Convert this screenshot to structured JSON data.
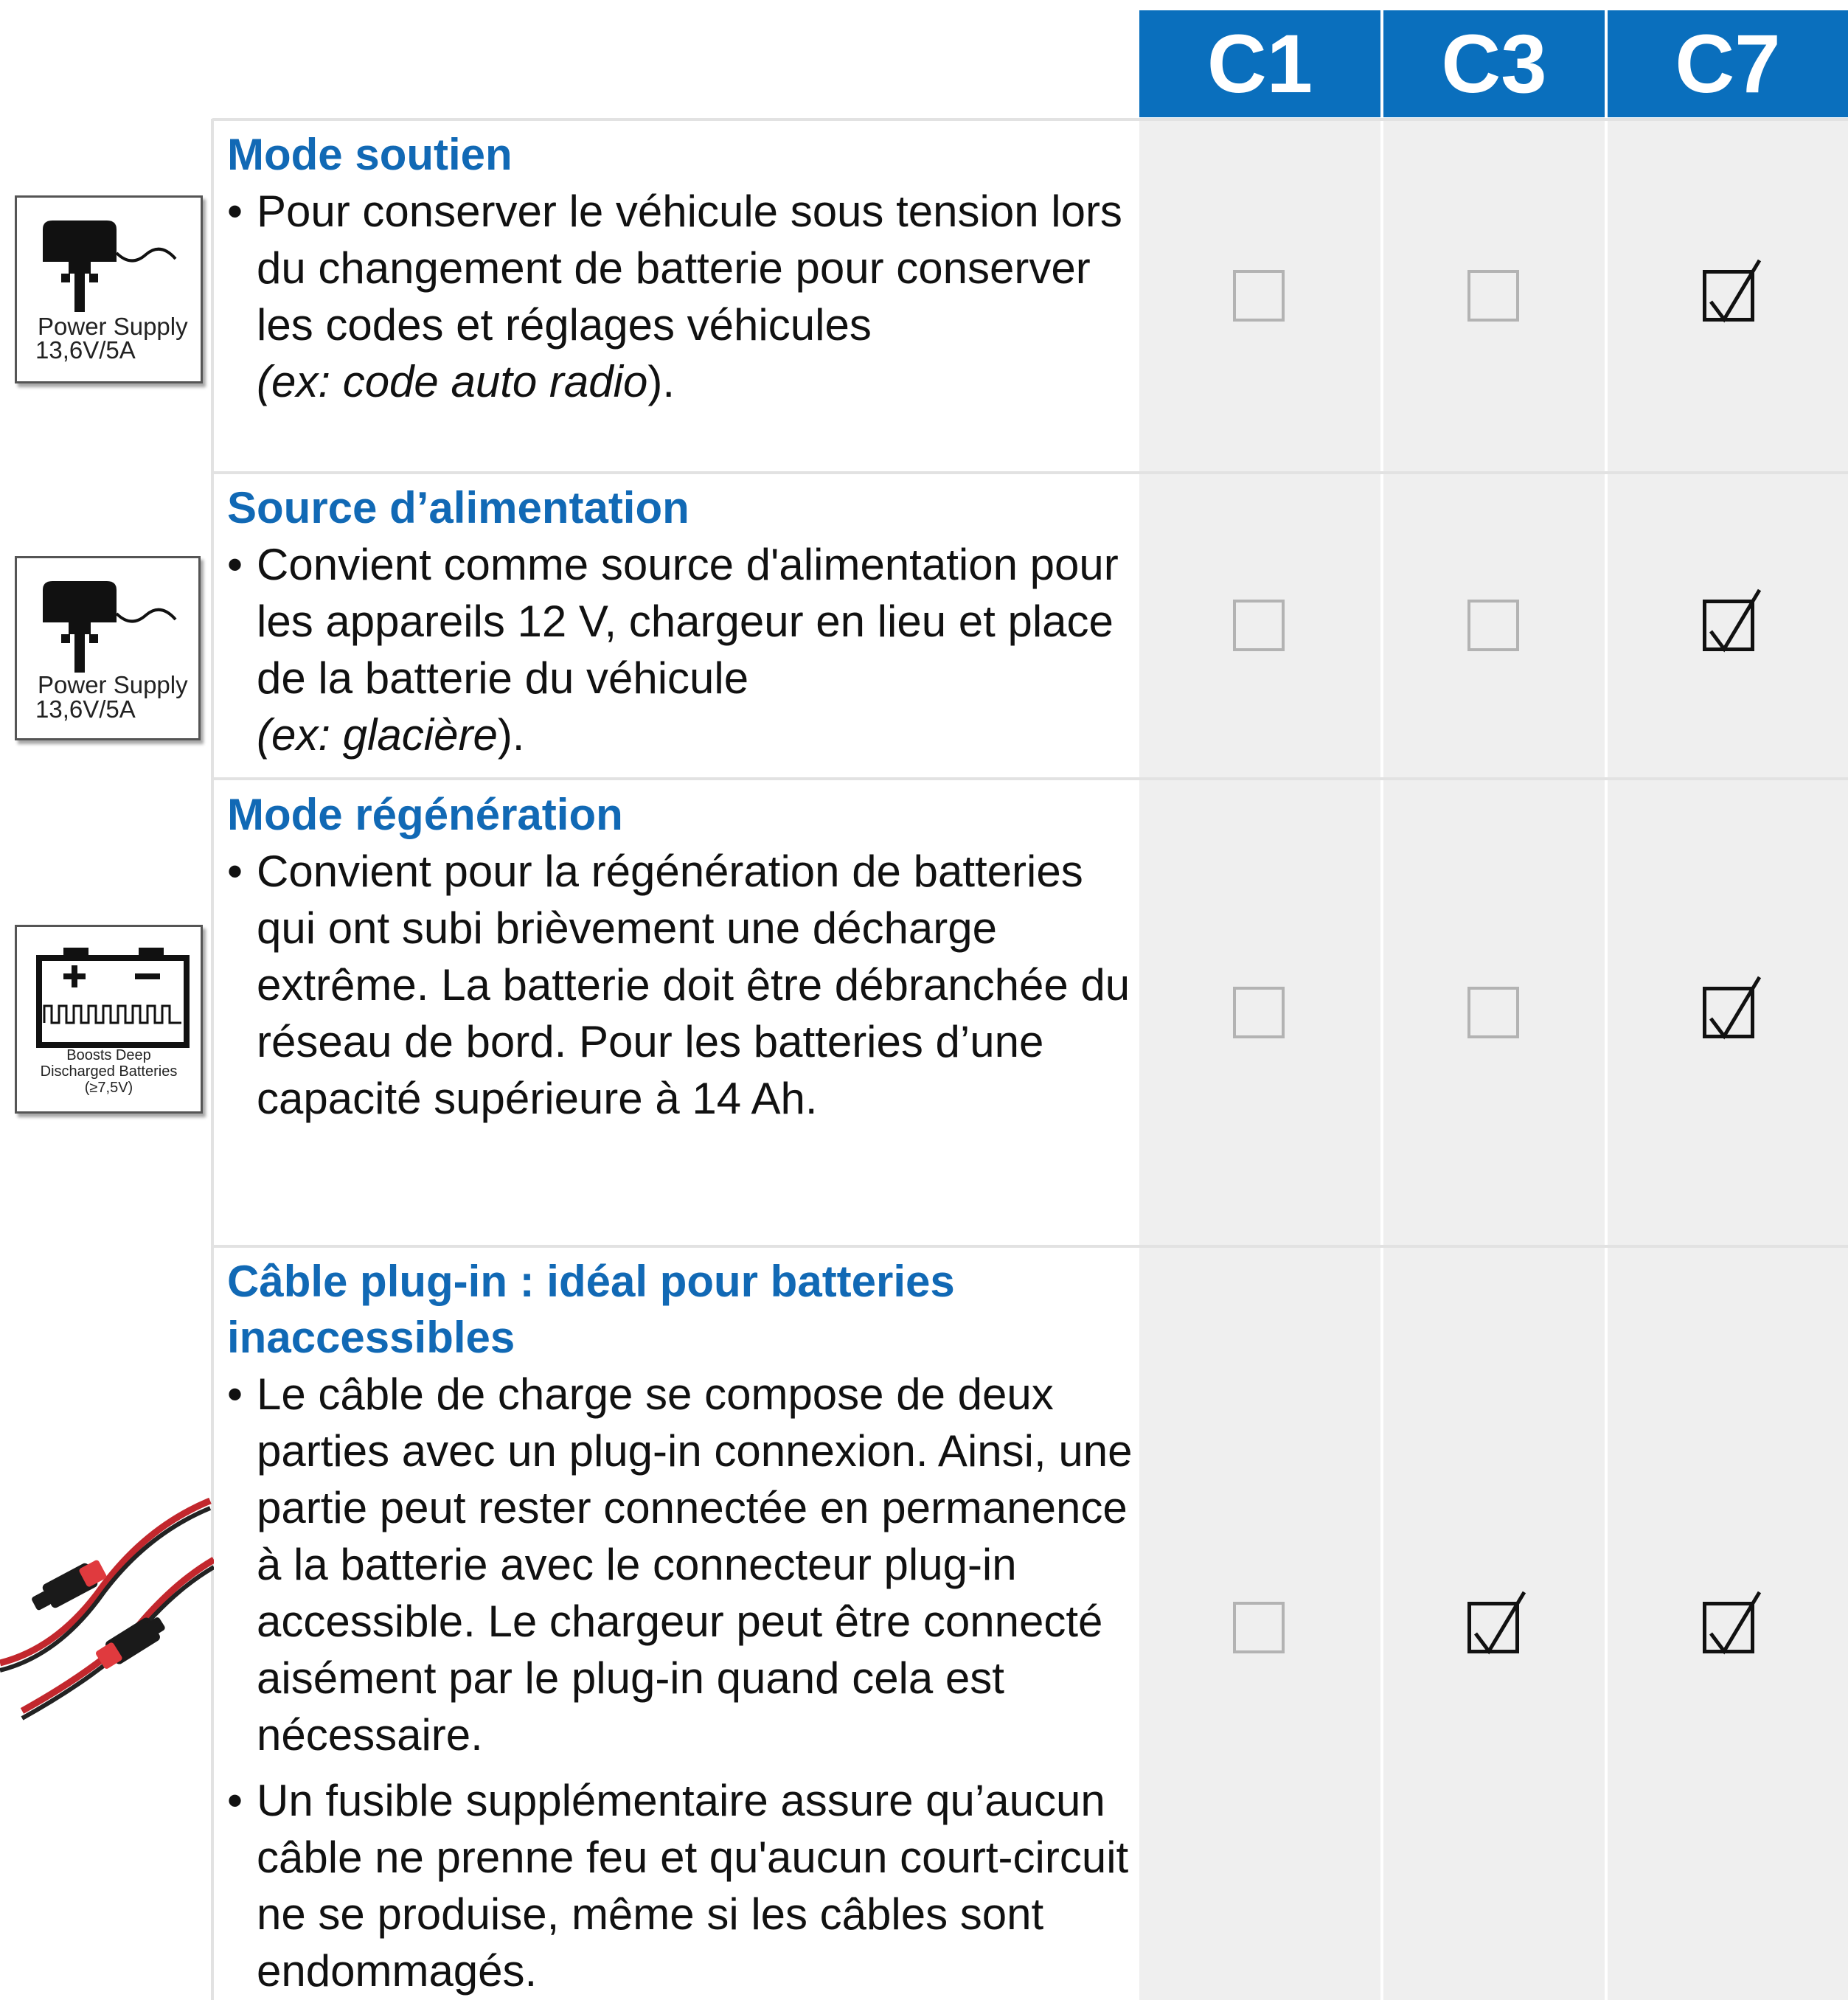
{
  "header": {
    "columns": [
      "C1",
      "C3",
      "C7"
    ]
  },
  "rows": [
    {
      "title": "Mode soutien",
      "bullets": [
        "Pour conserver le véhicule sous tension lors du changement de batterie pour conserver les codes et réglages véhicules"
      ],
      "example_open": "(ex: code auto radio",
      "example_close": ").",
      "icon": {
        "name": "power-supply-icon",
        "line1": "Power Supply",
        "line2": "13,6V/5A"
      },
      "checks": [
        false,
        false,
        true
      ]
    },
    {
      "title": "Source d’alimentation",
      "bullets": [
        "Convient comme source d'alimentation pour les appareils 12 V, chargeur en lieu et place de la batterie du véhicule"
      ],
      "example_open": "(ex: glacière",
      "example_close": ").",
      "icon": {
        "name": "power-supply-icon",
        "line1": "Power Supply",
        "line2": "13,6V/5A"
      },
      "checks": [
        false,
        false,
        true
      ]
    },
    {
      "title": "Mode régénération",
      "bullets": [
        "Convient pour la régénération de batteries qui ont subi brièvement une décharge extrême. La batterie doit être débranchée du réseau de bord. Pour les batteries d’une capacité supérieure à 14 Ah."
      ],
      "icon": {
        "name": "deep-discharge-battery-icon",
        "line1": "Boosts Deep",
        "line2": "Discharged Batteries",
        "line3": "(≥7,5V)"
      },
      "checks": [
        false,
        false,
        true
      ]
    },
    {
      "title": "Câble plug-in : idéal pour batteries inaccessibles",
      "bullets": [
        "Le câble de charge se compose de deux parties avec un plug-in connexion. Ainsi, une partie peut rester connectée en permanence à la batterie avec le connecteur plug-in accessible. Le chargeur peut être connecté aisément par le plug-in quand cela est nécessaire.",
        "Un fusible supplémentaire assure qu’aucun câble ne prenne feu et qu'aucun court-circuit ne se produise, même si les câbles sont endommagés."
      ],
      "icon": {
        "name": "plug-in-cable-icon"
      },
      "checks": [
        false,
        true,
        true
      ]
    }
  ]
}
